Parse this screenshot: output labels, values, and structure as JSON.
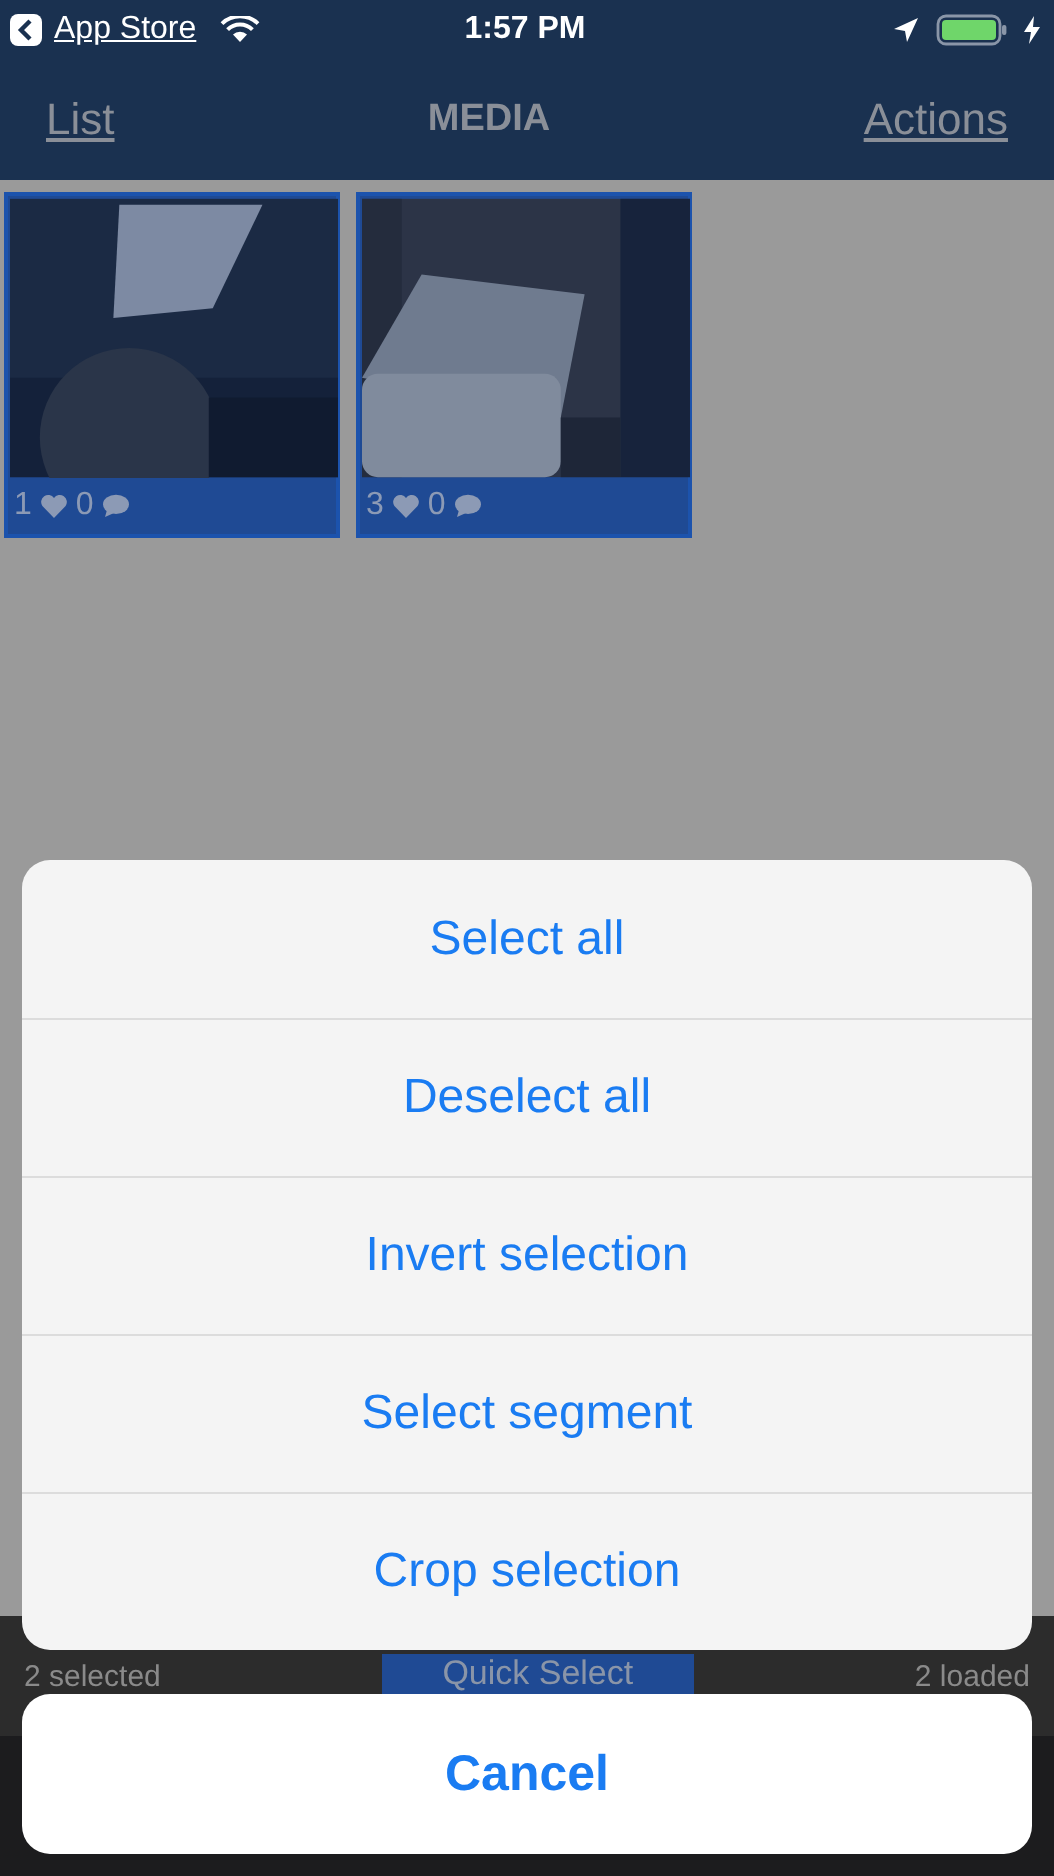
{
  "status_bar": {
    "back_label": "App Store",
    "time": "1:57 PM"
  },
  "nav": {
    "left": "List",
    "title": "MEDIA",
    "right": "Actions"
  },
  "media": [
    {
      "kind": "picture",
      "likes": "1",
      "comments": "0",
      "selected": true
    },
    {
      "kind": "picture",
      "likes": "3",
      "comments": "0",
      "selected": true
    }
  ],
  "footer": {
    "selected_count": "2 selected",
    "button": "Quick Select",
    "loaded": "2 loaded"
  },
  "action_sheet": {
    "actions": [
      "Select all",
      "Deselect all",
      "Invert selection",
      "Select segment",
      "Crop selection"
    ],
    "cancel": "Cancel"
  }
}
